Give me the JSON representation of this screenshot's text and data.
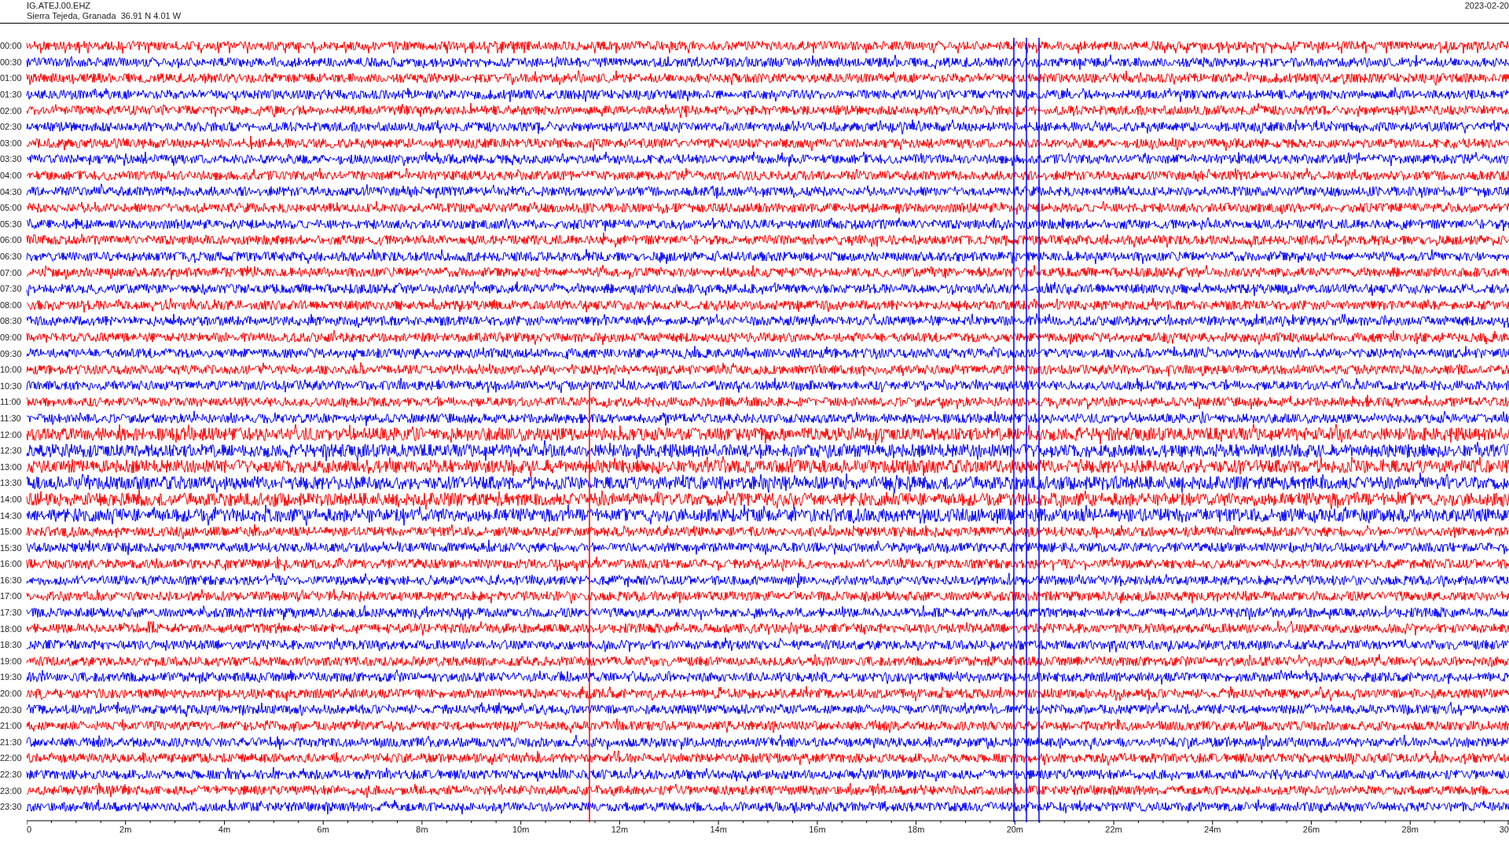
{
  "header": {
    "station": "IG.ATEJ.00.EHZ",
    "location": "Sierra Tejeda, Granada  36.91 N 4.01 W",
    "date": "2023-02-20"
  },
  "rows": [
    {
      "label": "00:00",
      "color": "#ff0000"
    },
    {
      "label": "00:30",
      "color": "#0000ff"
    },
    {
      "label": "01:00",
      "color": "#ff0000"
    },
    {
      "label": "01:30",
      "color": "#0000ff"
    },
    {
      "label": "02:00",
      "color": "#ff0000"
    },
    {
      "label": "02:30",
      "color": "#0000ff"
    },
    {
      "label": "03:00",
      "color": "#ff0000"
    },
    {
      "label": "03:30",
      "color": "#0000ff"
    },
    {
      "label": "04:00",
      "color": "#ff0000"
    },
    {
      "label": "04:30",
      "color": "#0000ff"
    },
    {
      "label": "05:00",
      "color": "#ff0000"
    },
    {
      "label": "05:30",
      "color": "#0000ff"
    },
    {
      "label": "06:00",
      "color": "#ff0000"
    },
    {
      "label": "06:30",
      "color": "#0000ff"
    },
    {
      "label": "07:00",
      "color": "#ff0000"
    },
    {
      "label": "07:30",
      "color": "#0000ff"
    },
    {
      "label": "08:00",
      "color": "#ff0000"
    },
    {
      "label": "08:30",
      "color": "#0000ff"
    },
    {
      "label": "09:00",
      "color": "#ff0000"
    },
    {
      "label": "09:30",
      "color": "#0000ff"
    },
    {
      "label": "10:00",
      "color": "#ff0000"
    },
    {
      "label": "10:30",
      "color": "#0000ff"
    },
    {
      "label": "11:00",
      "color": "#ff0000"
    },
    {
      "label": "11:30",
      "color": "#0000ff"
    },
    {
      "label": "12:00",
      "color": "#ff0000"
    },
    {
      "label": "12:30",
      "color": "#0000ff"
    },
    {
      "label": "13:00",
      "color": "#ff0000"
    },
    {
      "label": "13:30",
      "color": "#0000ff"
    },
    {
      "label": "14:00",
      "color": "#ff0000"
    },
    {
      "label": "14:30",
      "color": "#0000ff"
    },
    {
      "label": "15:00",
      "color": "#ff0000"
    },
    {
      "label": "15:30",
      "color": "#0000ff"
    },
    {
      "label": "16:00",
      "color": "#ff0000"
    },
    {
      "label": "16:30",
      "color": "#0000ff"
    },
    {
      "label": "17:00",
      "color": "#ff0000"
    },
    {
      "label": "17:30",
      "color": "#0000ff"
    },
    {
      "label": "18:00",
      "color": "#ff0000"
    },
    {
      "label": "18:30",
      "color": "#0000ff"
    },
    {
      "label": "19:00",
      "color": "#ff0000"
    },
    {
      "label": "19:30",
      "color": "#0000ff"
    },
    {
      "label": "20:00",
      "color": "#ff0000"
    },
    {
      "label": "20:30",
      "color": "#0000ff"
    },
    {
      "label": "21:00",
      "color": "#ff0000"
    },
    {
      "label": "21:30",
      "color": "#0000ff"
    },
    {
      "label": "22:00",
      "color": "#ff0000"
    },
    {
      "label": "22:30",
      "color": "#0000ff"
    },
    {
      "label": "23:00",
      "color": "#ff0000"
    },
    {
      "label": "23:30",
      "color": "#0000ff"
    }
  ],
  "axis": {
    "ticks": [
      "0",
      "2m",
      "4m",
      "6m",
      "8m",
      "10m",
      "12m",
      "14m",
      "16m",
      "18m",
      "20m",
      "22m",
      "24m",
      "26m",
      "28m",
      "30"
    ]
  }
}
